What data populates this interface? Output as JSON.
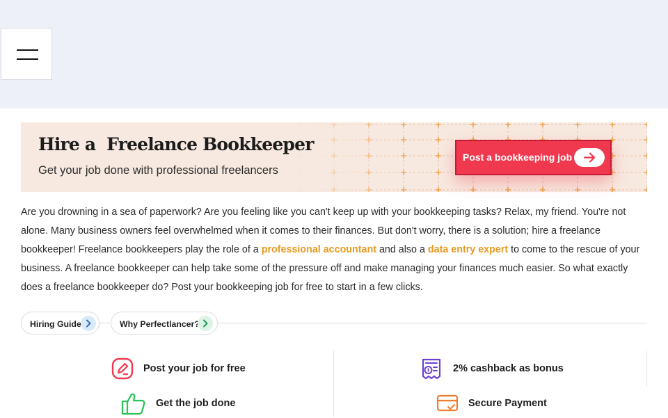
{
  "header": {
    "menu_icon": "hamburger-menu-icon"
  },
  "hero": {
    "title": "Hire a  Freelance Bookkeeper",
    "subtitle": "Get your job done with professional freelancers",
    "cta_label": "Post a bookkeeping job",
    "cta_icon": "arrow-right-icon",
    "accent_color": "#f0394f",
    "background_color": "#f7e9df"
  },
  "intro": {
    "part1": "Are you drowning in a sea of paperwork? Are you feeling like you can't keep up with your bookkeeping tasks? Relax, my friend. You're not alone. Many business owners feel overwhelmed when it comes to their finances. But don't worry, there is a solution; hire a freelance bookkeeper! Freelance bookkeepers play the role of a ",
    "link1": "professional accountant",
    "part2": " and also a ",
    "link2": "data entry expert",
    "part3": " to come to the rescue of your business. A freelance bookkeeper can help take some of the pressure off and make managing your finances much easier. So what exactly does a freelance bookkeeper do? Post your bookkeeping job for free to start in a few clicks.",
    "link_color": "#e89a1f"
  },
  "chips": [
    {
      "label": "Hiring Guide",
      "icon": "chevron-right-icon"
    },
    {
      "label": "Why Perfectlancer?",
      "icon": "chevron-right-icon"
    }
  ],
  "features": [
    {
      "label": "Post your job for free",
      "icon": "edit-pencil-icon",
      "color": "#f0394f"
    },
    {
      "label": "2% cashback as bonus",
      "icon": "cashback-receipt-icon",
      "color": "#6a3fd6"
    },
    {
      "label": "Get the job done",
      "icon": "thumbs-up-icon",
      "color": "#2ec25b"
    },
    {
      "label": "Secure Payment",
      "icon": "secure-card-icon",
      "color": "#f07d2d"
    }
  ]
}
